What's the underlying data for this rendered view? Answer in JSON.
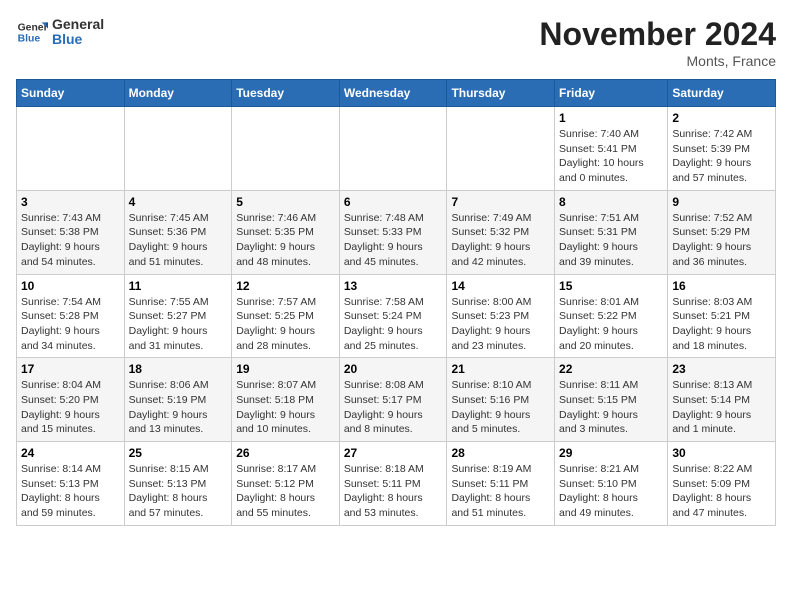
{
  "logo": {
    "line1": "General",
    "line2": "Blue"
  },
  "title": "November 2024",
  "location": "Monts, France",
  "days_of_week": [
    "Sunday",
    "Monday",
    "Tuesday",
    "Wednesday",
    "Thursday",
    "Friday",
    "Saturday"
  ],
  "weeks": [
    [
      {
        "day": "",
        "info": ""
      },
      {
        "day": "",
        "info": ""
      },
      {
        "day": "",
        "info": ""
      },
      {
        "day": "",
        "info": ""
      },
      {
        "day": "",
        "info": ""
      },
      {
        "day": "1",
        "info": "Sunrise: 7:40 AM\nSunset: 5:41 PM\nDaylight: 10 hours\nand 0 minutes."
      },
      {
        "day": "2",
        "info": "Sunrise: 7:42 AM\nSunset: 5:39 PM\nDaylight: 9 hours\nand 57 minutes."
      }
    ],
    [
      {
        "day": "3",
        "info": "Sunrise: 7:43 AM\nSunset: 5:38 PM\nDaylight: 9 hours\nand 54 minutes."
      },
      {
        "day": "4",
        "info": "Sunrise: 7:45 AM\nSunset: 5:36 PM\nDaylight: 9 hours\nand 51 minutes."
      },
      {
        "day": "5",
        "info": "Sunrise: 7:46 AM\nSunset: 5:35 PM\nDaylight: 9 hours\nand 48 minutes."
      },
      {
        "day": "6",
        "info": "Sunrise: 7:48 AM\nSunset: 5:33 PM\nDaylight: 9 hours\nand 45 minutes."
      },
      {
        "day": "7",
        "info": "Sunrise: 7:49 AM\nSunset: 5:32 PM\nDaylight: 9 hours\nand 42 minutes."
      },
      {
        "day": "8",
        "info": "Sunrise: 7:51 AM\nSunset: 5:31 PM\nDaylight: 9 hours\nand 39 minutes."
      },
      {
        "day": "9",
        "info": "Sunrise: 7:52 AM\nSunset: 5:29 PM\nDaylight: 9 hours\nand 36 minutes."
      }
    ],
    [
      {
        "day": "10",
        "info": "Sunrise: 7:54 AM\nSunset: 5:28 PM\nDaylight: 9 hours\nand 34 minutes."
      },
      {
        "day": "11",
        "info": "Sunrise: 7:55 AM\nSunset: 5:27 PM\nDaylight: 9 hours\nand 31 minutes."
      },
      {
        "day": "12",
        "info": "Sunrise: 7:57 AM\nSunset: 5:25 PM\nDaylight: 9 hours\nand 28 minutes."
      },
      {
        "day": "13",
        "info": "Sunrise: 7:58 AM\nSunset: 5:24 PM\nDaylight: 9 hours\nand 25 minutes."
      },
      {
        "day": "14",
        "info": "Sunrise: 8:00 AM\nSunset: 5:23 PM\nDaylight: 9 hours\nand 23 minutes."
      },
      {
        "day": "15",
        "info": "Sunrise: 8:01 AM\nSunset: 5:22 PM\nDaylight: 9 hours\nand 20 minutes."
      },
      {
        "day": "16",
        "info": "Sunrise: 8:03 AM\nSunset: 5:21 PM\nDaylight: 9 hours\nand 18 minutes."
      }
    ],
    [
      {
        "day": "17",
        "info": "Sunrise: 8:04 AM\nSunset: 5:20 PM\nDaylight: 9 hours\nand 15 minutes."
      },
      {
        "day": "18",
        "info": "Sunrise: 8:06 AM\nSunset: 5:19 PM\nDaylight: 9 hours\nand 13 minutes."
      },
      {
        "day": "19",
        "info": "Sunrise: 8:07 AM\nSunset: 5:18 PM\nDaylight: 9 hours\nand 10 minutes."
      },
      {
        "day": "20",
        "info": "Sunrise: 8:08 AM\nSunset: 5:17 PM\nDaylight: 9 hours\nand 8 minutes."
      },
      {
        "day": "21",
        "info": "Sunrise: 8:10 AM\nSunset: 5:16 PM\nDaylight: 9 hours\nand 5 minutes."
      },
      {
        "day": "22",
        "info": "Sunrise: 8:11 AM\nSunset: 5:15 PM\nDaylight: 9 hours\nand 3 minutes."
      },
      {
        "day": "23",
        "info": "Sunrise: 8:13 AM\nSunset: 5:14 PM\nDaylight: 9 hours\nand 1 minute."
      }
    ],
    [
      {
        "day": "24",
        "info": "Sunrise: 8:14 AM\nSunset: 5:13 PM\nDaylight: 8 hours\nand 59 minutes."
      },
      {
        "day": "25",
        "info": "Sunrise: 8:15 AM\nSunset: 5:13 PM\nDaylight: 8 hours\nand 57 minutes."
      },
      {
        "day": "26",
        "info": "Sunrise: 8:17 AM\nSunset: 5:12 PM\nDaylight: 8 hours\nand 55 minutes."
      },
      {
        "day": "27",
        "info": "Sunrise: 8:18 AM\nSunset: 5:11 PM\nDaylight: 8 hours\nand 53 minutes."
      },
      {
        "day": "28",
        "info": "Sunrise: 8:19 AM\nSunset: 5:11 PM\nDaylight: 8 hours\nand 51 minutes."
      },
      {
        "day": "29",
        "info": "Sunrise: 8:21 AM\nSunset: 5:10 PM\nDaylight: 8 hours\nand 49 minutes."
      },
      {
        "day": "30",
        "info": "Sunrise: 8:22 AM\nSunset: 5:09 PM\nDaylight: 8 hours\nand 47 minutes."
      }
    ]
  ]
}
